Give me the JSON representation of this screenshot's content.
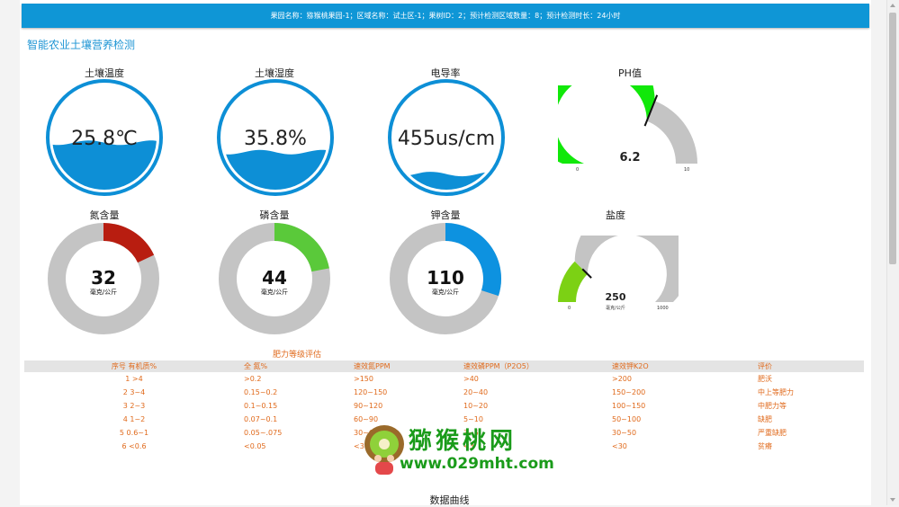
{
  "header": {
    "info": "果园名称：猕猴桃果园-1；区域名称：试土区-1；果树ID：2；预计检测区域数量：8；预计检测时长：24小时"
  },
  "app": {
    "title": "智能农业土壤营养检测"
  },
  "liquid_gauges": [
    {
      "label": "土壤温度",
      "value": "25.8℃",
      "level": 0.45
    },
    {
      "label": "土壤湿度",
      "value": "35.8%",
      "level": 0.36
    },
    {
      "label": "电导率",
      "value": "455us/cm",
      "level": 0.15
    }
  ],
  "ph": {
    "label": "PH值",
    "value": "6.2",
    "min": "0",
    "max": "10",
    "level": 0.62,
    "fill_color": "#11e80a"
  },
  "donuts": [
    {
      "label": "氮含量",
      "value": "32",
      "unit": "毫克/公斤",
      "fraction": 0.18,
      "color": "#b81d10"
    },
    {
      "label": "磷含量",
      "value": "44",
      "unit": "毫克/公斤",
      "fraction": 0.22,
      "color": "#5ac93a"
    },
    {
      "label": "钾含量",
      "value": "110",
      "unit": "毫克/公斤",
      "fraction": 0.3,
      "color": "#0d92e0"
    }
  ],
  "salinity": {
    "label": "盐度",
    "value": "250",
    "unit": "毫克/公斤",
    "min": "0",
    "max": "1000",
    "level": 0.25,
    "fill_color": "#7cd114"
  },
  "grade_table": {
    "title": "肥力等级评估",
    "headers": [
      "序号 有机质%",
      "全 氮%",
      "速效氮PPM",
      "速效磷PPM（P2O5）",
      "速效钾K2O",
      "评价"
    ],
    "rows": [
      [
        "1 >4",
        ">0.2",
        ">150",
        ">40",
        ">200",
        "肥沃"
      ],
      [
        "2 3~4",
        "0.15~0.2",
        "120~150",
        "20~40",
        "150~200",
        "中上等肥力"
      ],
      [
        "3 2~3",
        "0.1~0.15",
        "90~120",
        "10~20",
        "100~150",
        "中肥力等"
      ],
      [
        "4 1~2",
        "0.07~0.1",
        "60~90",
        "5~10",
        "50~100",
        "缺肥"
      ],
      [
        "5 0.6~1",
        "0.05~.075",
        "30~60",
        "3~5",
        "30~50",
        "严重缺肥"
      ],
      [
        "6 <0.6",
        "<0.05",
        "<30",
        "<3",
        "<30",
        "贫瘠"
      ]
    ]
  },
  "bottom": {
    "title": "数据曲线"
  },
  "watermark": {
    "name": "猕猴桃网",
    "url": "www.029mht.com"
  }
}
